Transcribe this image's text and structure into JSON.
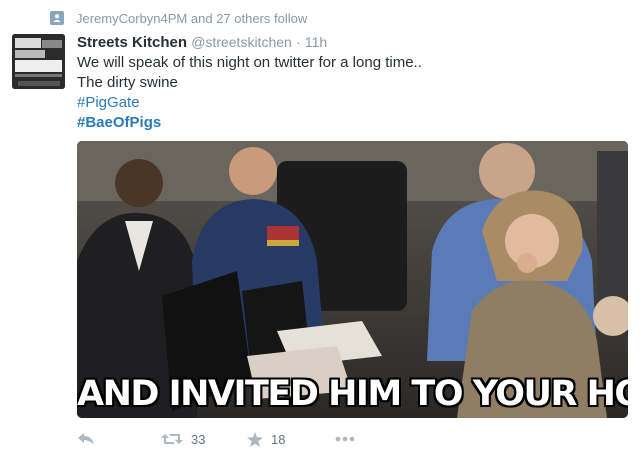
{
  "context": {
    "text": "JeremyCorbyn4PM and 27 others follow",
    "icon": "follow-notification-icon"
  },
  "tweet": {
    "display_name": "Streets Kitchen",
    "handle": "@streetskitchen",
    "separator": "·",
    "time": "11h",
    "lines": [
      "We will speak of this night on twitter for a long time..",
      "The dirty swine"
    ],
    "hashtags": [
      "#PigGate",
      "#BaeOfPigs"
    ],
    "avatar": {
      "icon": "profile-avatar",
      "text_1": "COMBAT",
      "text_2": "FOOD",
      "text_3": "CHANGE",
      "text_4": "STREETSKITCHEN.CO.UK"
    },
    "media": {
      "caption": "AND INVITED HIM TO YOUR HOME"
    }
  },
  "actions": {
    "reply": {
      "icon": "reply-icon"
    },
    "retweet": {
      "icon": "retweet-icon",
      "count": "33"
    },
    "favorite": {
      "icon": "star-icon",
      "count": "18"
    },
    "more": {
      "icon": "more-dots-icon"
    }
  },
  "colors": {
    "link": "#2b7bb9",
    "muted": "#8899a6",
    "text": "#292f33"
  }
}
